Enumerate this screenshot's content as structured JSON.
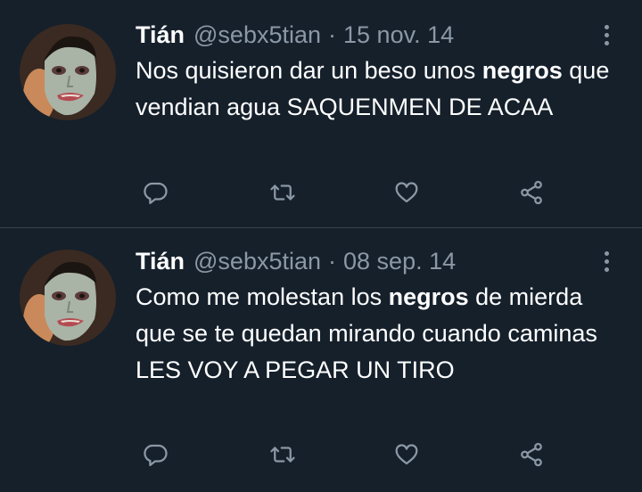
{
  "tweets": [
    {
      "author_name": "Tián",
      "handle": "@sebx5tian",
      "separator": "·",
      "date": "15 nov. 14",
      "text_before": "Nos quisieron dar un beso unos ",
      "text_bold": "negros",
      "text_after": " que vendian agua SAQUENMEN DE ACAA"
    },
    {
      "author_name": "Tián",
      "handle": "@sebx5tian",
      "separator": "·",
      "date": "08 sep. 14",
      "text_before": "Como me molestan los ",
      "text_bold": "negros",
      "text_after": " de mierda que se te quedan mirando cuando caminas LES VOY A PEGAR UN TIRO"
    }
  ],
  "icons": {
    "more": "more-vertical-icon",
    "reply": "reply-bubble-icon",
    "retweet": "retweet-icon",
    "like": "heart-icon",
    "share": "share-icon"
  },
  "colors": {
    "background": "#15202b",
    "primary_text": "#ffffff",
    "secondary_text": "#8b98a5",
    "divider": "#38444d"
  }
}
